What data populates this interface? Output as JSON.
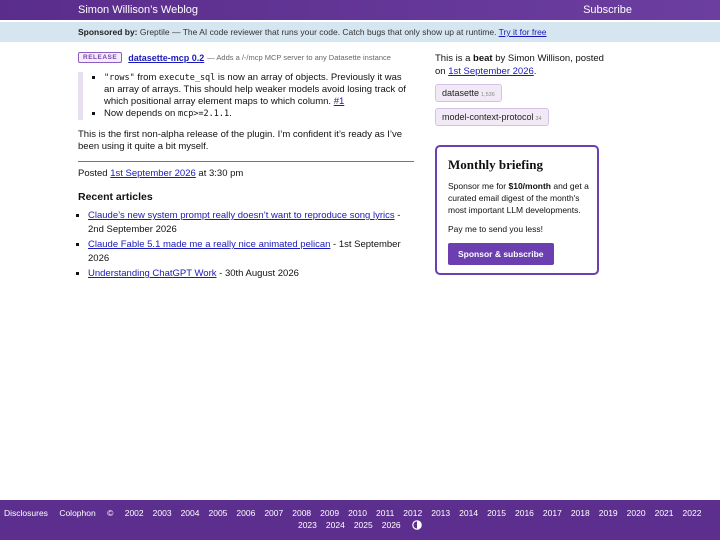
{
  "header": {
    "title": "Simon Willison’s Weblog",
    "subscribe": "Subscribe"
  },
  "sponsor": {
    "label": "Sponsored by:",
    "text": "Greptile — The AI code reviewer that runs your code. Catch bugs that only show up at runtime.",
    "link": "Try it for free"
  },
  "entry": {
    "badge": "RELEASE",
    "name": "datasette-mcp 0.2",
    "desc": "— Adds a /-/mcp MCP server to any Datasette instance",
    "changes": {
      "item1_code1": "\"rows\"",
      "item1_t1": " from ",
      "item1_code2": "execute_sql",
      "item1_t2": " is now an array of objects. Previously it was an array of arrays. This should help weaker models avoid losing track of which positional array element maps to which column. ",
      "item1_link": "#1",
      "item2_t1": "Now depends on ",
      "item2_code": "mcp>=2.1.1",
      "item2_t2": "."
    },
    "paragraph": "This is the first non-alpha release of the plugin. I’m confident it’s ready as I’ve been using it quite a bit myself.",
    "posted_prefix": "Posted",
    "posted_date": "1st September 2026",
    "posted_suffix": "at 3:30 pm"
  },
  "recent": {
    "title": "Recent articles",
    "items": [
      {
        "title": "Claude’s new system prompt really doesn’t want to reproduce song lyrics",
        "date": " - 2nd September 2026"
      },
      {
        "title": "Claude Fable 5.1 made me a really nice animated pelican",
        "date": " - 1st September 2026"
      },
      {
        "title": "Understanding ChatGPT Work",
        "date": " - 30th August 2026"
      }
    ]
  },
  "sidebar": {
    "meta_prefix": "This is a ",
    "meta_kind": "beat",
    "meta_mid": " by Simon Willison, posted on ",
    "meta_date": "1st September 2026",
    "meta_end": ".",
    "tags": [
      {
        "name": "datasette",
        "count": "1,536"
      },
      {
        "name": "model-context-protocol",
        "count": "34"
      }
    ]
  },
  "briefing": {
    "title": "Monthly briefing",
    "p1_a": "Sponsor me for ",
    "p1_price": "$10/month",
    "p1_b": " and get a curated email digest of the month's most important LLM developments.",
    "p2": "Pay me to send you less!",
    "cta": "Sponsor & subscribe"
  },
  "footer": {
    "links": [
      "Disclosures",
      "Colophon"
    ],
    "copyright": "©",
    "years_row1": [
      "2002",
      "2003",
      "2004",
      "2005",
      "2006",
      "2007",
      "2008",
      "2009",
      "2010",
      "2011",
      "2012",
      "2013",
      "2014",
      "2015",
      "2016",
      "2017",
      "2018",
      "2019",
      "2020",
      "2021",
      "2022"
    ],
    "years_row2": [
      "2023",
      "2024",
      "2025",
      "2026"
    ],
    "theme_icon": "contrast-toggle-icon"
  },
  "colors": {
    "brand": "#5c2f8f",
    "accent": "#6b3fb0",
    "sponsor_bg": "#d6e6f1",
    "link": "#1a1ab8"
  }
}
